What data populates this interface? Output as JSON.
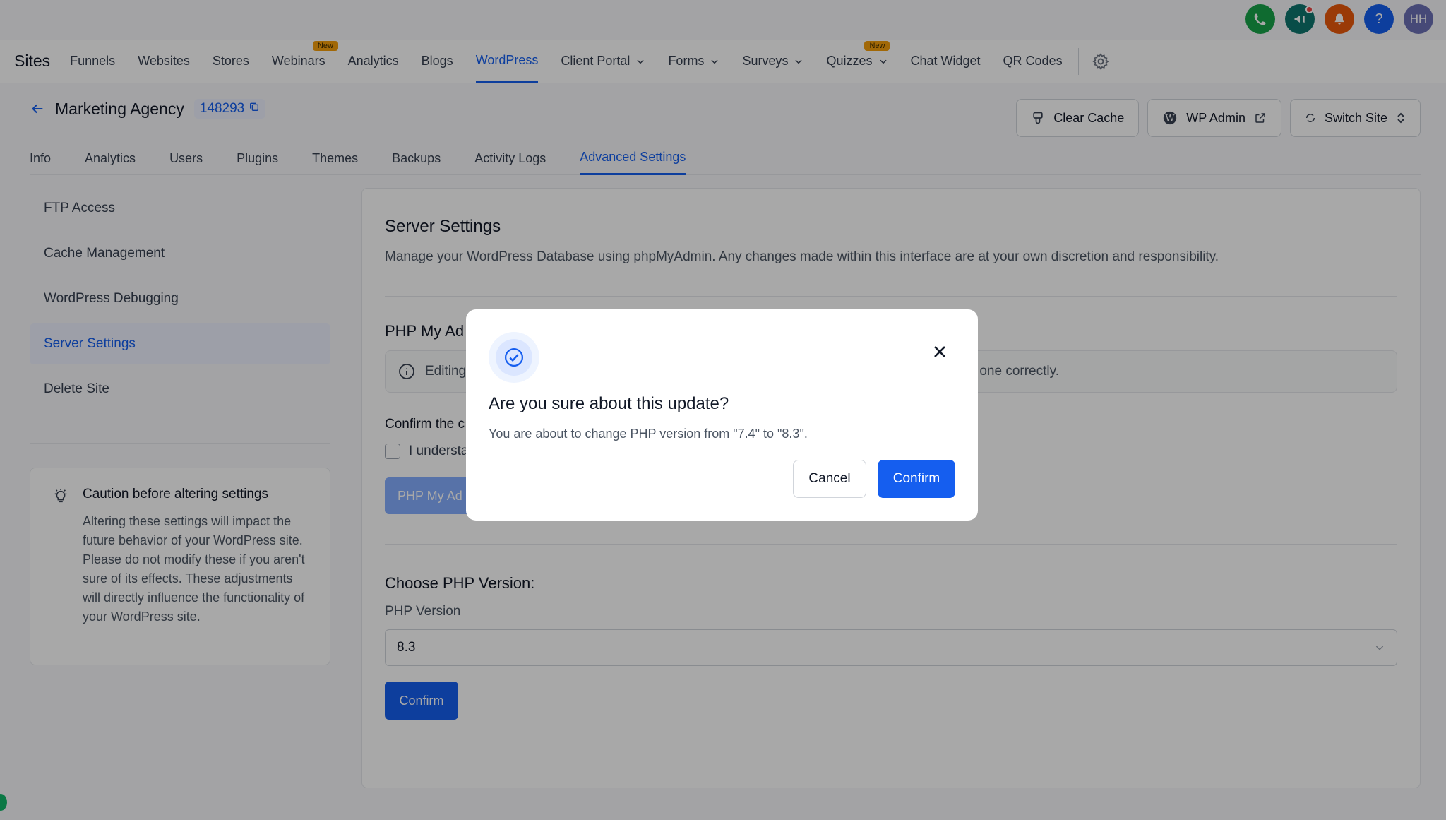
{
  "top_icons": [
    {
      "name": "phone-icon",
      "color": "#17a34a",
      "glyph": "✆"
    },
    {
      "name": "megaphone-icon",
      "color": "#0f766e",
      "glyph": "📢"
    },
    {
      "name": "bell-icon",
      "color": "#ea580c",
      "glyph": "🔔"
    },
    {
      "name": "help-icon",
      "color": "#155eef",
      "glyph": "?"
    },
    {
      "name": "avatar",
      "color": "#6b6fb5",
      "glyph": "HH"
    }
  ],
  "nav": {
    "brand": "Sites",
    "items": [
      "Funnels",
      "Websites",
      "Stores",
      "Webinars",
      "Analytics",
      "Blogs",
      "WordPress",
      "Client Portal",
      "Forms",
      "Surveys",
      "Quizzes",
      "Chat Widget",
      "QR Codes"
    ],
    "new_badge": "New"
  },
  "header": {
    "title": "Marketing Agency",
    "site_id": "148293",
    "clear_cache": "Clear Cache",
    "wp_admin": "WP Admin",
    "switch_site": "Switch Site"
  },
  "tabs": [
    "Info",
    "Analytics",
    "Users",
    "Plugins",
    "Themes",
    "Backups",
    "Activity Logs",
    "Advanced Settings"
  ],
  "sidebar": {
    "items": [
      "FTP Access",
      "Cache Management",
      "WordPress Debugging",
      "Server Settings",
      "Delete Site"
    ]
  },
  "caution": {
    "title": "Caution before altering settings",
    "text": "Altering these settings will impact the future behavior of your WordPress site. Please do not modify these if you aren't sure of its effects. These adjustments will directly influence the functionality of your WordPress site."
  },
  "main": {
    "title": "Server Settings",
    "description": "Manage your WordPress Database using phpMyAdmin. Any changes made within this interface are at your own discretion and responsibility.",
    "pma_title": "PHP My Ad",
    "info_left": "Editing",
    "info_right": "one correctly.",
    "confirm_label": "Confirm the c",
    "checkbox_label": "I understa",
    "pma_button": "PHP My Ad",
    "php_heading": "Choose PHP Version:",
    "php_label": "PHP Version",
    "php_value": "8.3",
    "confirm_button": "Confirm"
  },
  "modal": {
    "title": "Are you sure about this update?",
    "message": "You are about to change PHP version from \"7.4\" to \"8.3\".",
    "cancel": "Cancel",
    "confirm": "Confirm"
  }
}
